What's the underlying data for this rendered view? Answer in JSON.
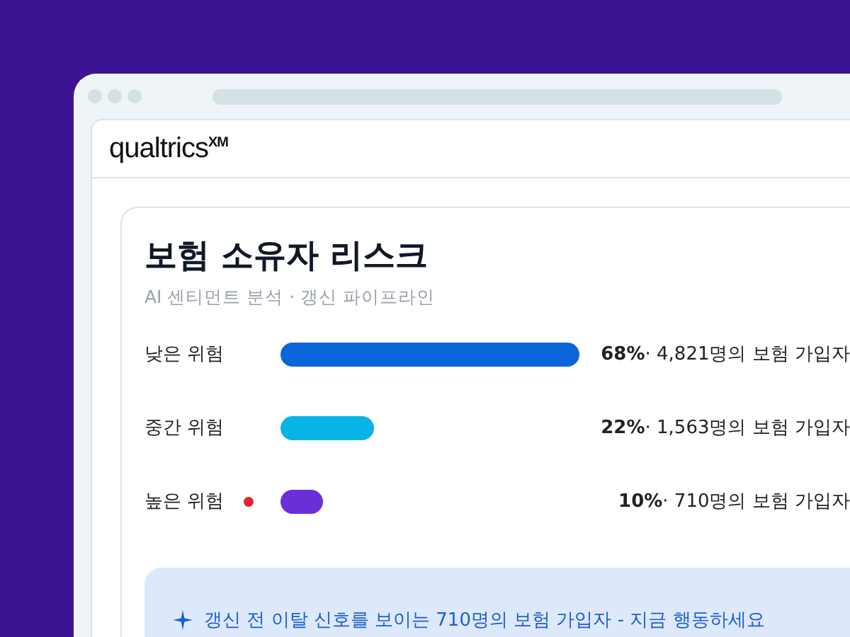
{
  "app": {
    "logo": "qualtrics",
    "logo_mark": "XM"
  },
  "card": {
    "title": "보험 소유자 리스크",
    "subtitle": "AI 센티먼트 분석 · 갱신 파이프라인",
    "risks": [
      {
        "label": "낮은 위험",
        "alert": false,
        "color": "#0a66d8",
        "reading": "**68%**· 4,821명의 보험 가입자"
      },
      {
        "label": "중간 위험",
        "alert": false,
        "color": "#08b3e8",
        "reading": "**22%**· 1,563명의 보험 가입자"
      },
      {
        "label": "높은 위험",
        "alert": true,
        "color": "#6a2fd9",
        "reading": "**10%**· 710명의 보험 가입자"
      }
    ],
    "banner": "갱신 전 이탈 신호를 보이는 710명의 보험 가입자 - 지금 행동하세요"
  }
}
